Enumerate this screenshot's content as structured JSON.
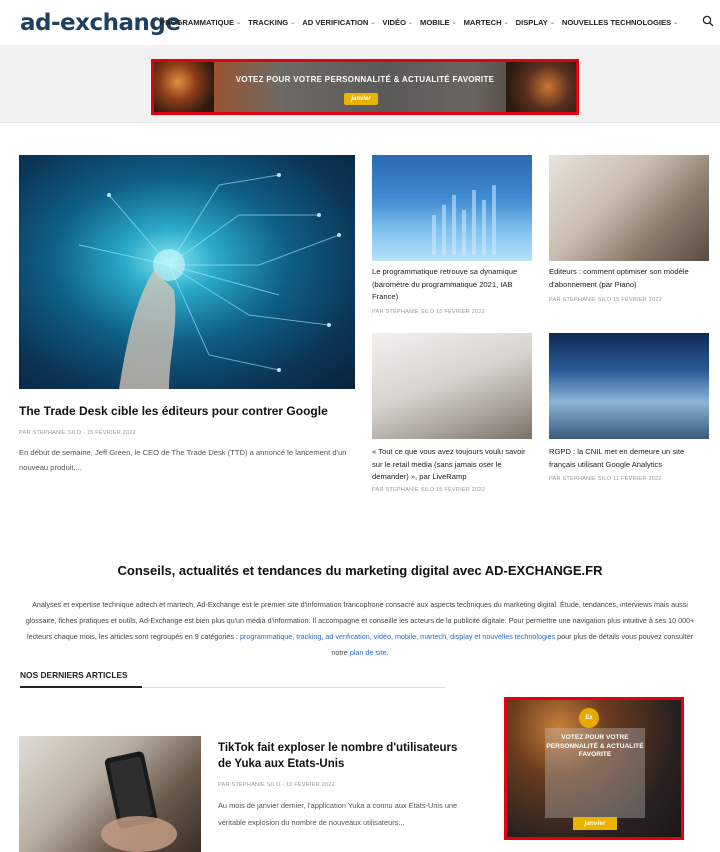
{
  "site": {
    "logo": "ad-exchange"
  },
  "nav": [
    "PROGRAMMATIQUE",
    "TRACKING",
    "AD VERIFICATION",
    "VIDÉO",
    "MOBILE",
    "MARTECH",
    "DISPLAY",
    "NOUVELLES TECHNOLOGIES"
  ],
  "top_banner": {
    "text": "VOTEZ POUR VOTRE PERSONNALITÉ & ACTUALITÉ FAVORITE",
    "button": "janvier"
  },
  "featured": {
    "title": "The Trade Desk cible les éditeurs pour contrer Google",
    "meta": "PAR STEPHANIE SILO  -  15 FÉVRIER 2022",
    "excerpt": "En début de semaine, Jeff Green, le CEO de The Trade Desk (TTD) a annoncé le lancement d'un nouveau produit,..."
  },
  "cards": [
    {
      "title": "Le programmatique retrouve sa dynamique (baromètre du programmatique 2021, IAB France)",
      "meta": "PAR STEPHANIE SILO  15 FÉVRIER 2022"
    },
    {
      "title": "Editeurs : comment optimiser son modèle d'abonnement (par Piano)",
      "meta": "PAR STEPHANIE SILO  15 FÉVRIER 2022"
    },
    {
      "title": "« Tout ce que vous avez toujours voulu savoir sur le retail media (sans jamais oser le demander) », par LiveRamp",
      "meta": "PAR STEPHANIE SILO  15 FÉVRIER 2022"
    },
    {
      "title": "RGPD : la CNIL met en demeure un site français utilisant Google Analytics",
      "meta": "PAR STEPHANIE SILO  11 FÉVRIER 2022"
    }
  ],
  "section": {
    "title": "Conseils, actualités et tendances du marketing digital avec AD-EXCHANGE.FR",
    "text_1": "Analyses et expertise technique adtech et martech, Ad-Exchange est le premier site d'information francophone consacré aux aspects techniques du marketing digital. Étude, tendances, interviews mais aussi glossaire, fiches pratiques et outils, Ad-Exchange est bien plus qu'un média d'information. Il accompagne et conseille les acteurs de la publicité digitale. Pour permettre une navigation plus intuitive à ses 10 000+ lecteurs chaque mois, les articles sont regroupés en 9 catégories : ",
    "link_categories": "programmatique, tracking, ad verification, vidéo, mobile, martech, display et nouvelles technologies",
    "text_2": " pour plus de détails vous pouvez consulter notre ",
    "link_sitemap": "plan de site",
    "text_3": "."
  },
  "latest": {
    "label": "NOS DERNIERS ARTICLES",
    "article": {
      "title": "TikTok fait exploser le nombre d'utilisateurs de Yuka aux Etats-Unis",
      "meta": "PAR STEPHANIE SILO  -  10 FÉVRIER 2022",
      "excerpt": "Au mois de janvier dernier, l'application Yuka a connu aux Etats-Unis une véritable explosion du nombre de nouveaux utilisateurs..."
    }
  },
  "side_ad": {
    "badge": "Ex",
    "text": "VOTEZ POUR VOTRE PERSONNALITÉ & ACTUALITÉ FAVORITE",
    "button": "janvier"
  },
  "colors": {
    "brand": "#1f3f63",
    "ad_border": "#e3000f",
    "link": "#2a6ac0",
    "gold": "#e8b400"
  }
}
